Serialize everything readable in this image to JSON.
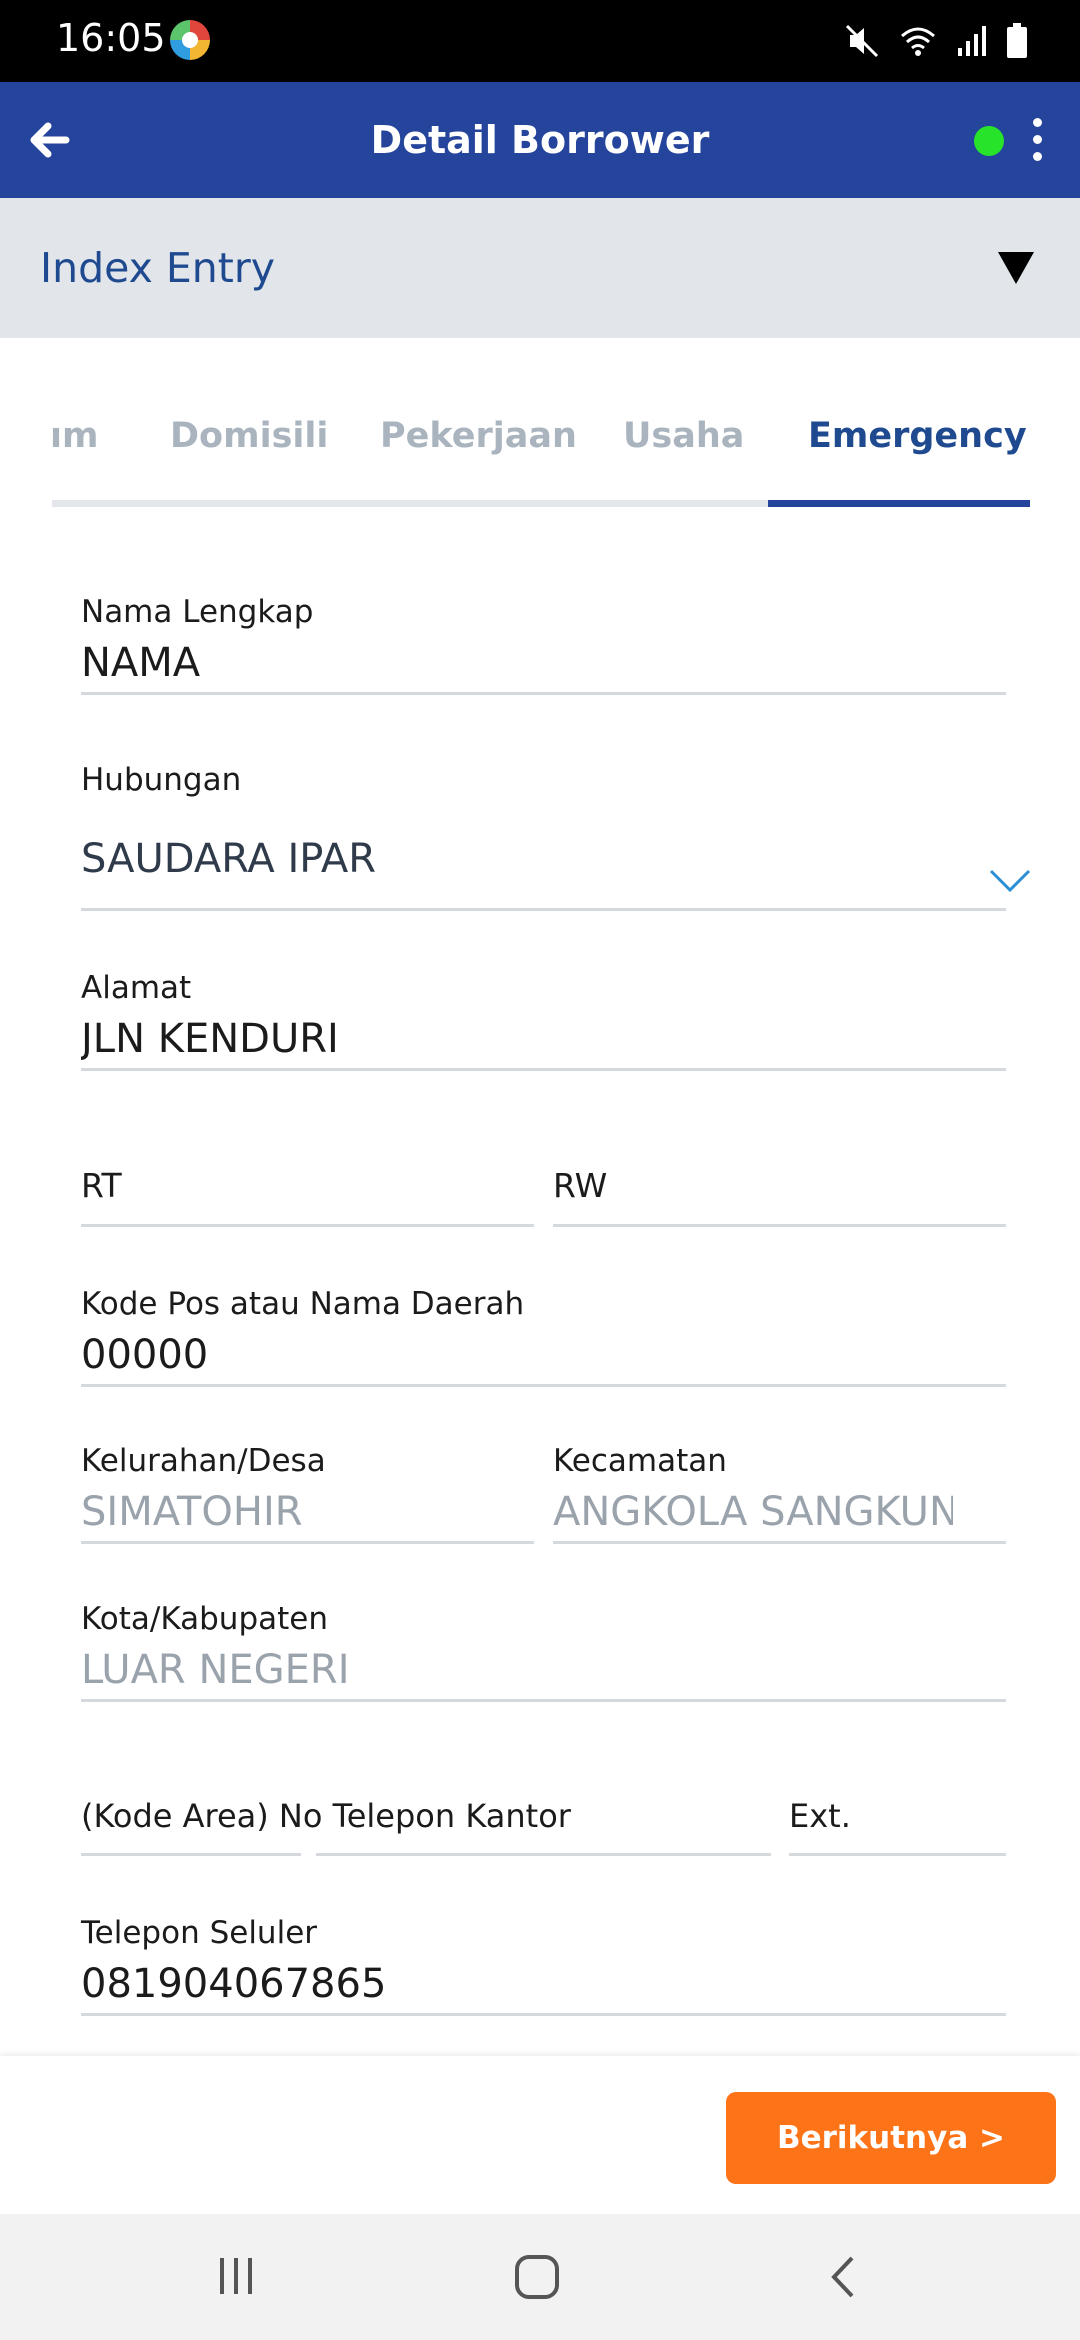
{
  "status_bar": {
    "time": "16:05",
    "icons": [
      "app-notification-icon",
      "mute-icon",
      "wifi-icon",
      "signal-icon",
      "battery-icon"
    ]
  },
  "app_bar": {
    "title": "Detail Borrower",
    "online_color": "#27e32a"
  },
  "index_entry": {
    "title": "Index Entry"
  },
  "tabs": [
    {
      "label": "ım"
    },
    {
      "label": "Domisili"
    },
    {
      "label": "Pekerjaan"
    },
    {
      "label": "Usaha"
    },
    {
      "label": "Emergency",
      "active": true
    }
  ],
  "form": {
    "nama_lengkap": {
      "label": "Nama Lengkap",
      "value": "NAMA"
    },
    "hubungan": {
      "label": "Hubungan",
      "value": "SAUDARA IPAR"
    },
    "alamat": {
      "label": "Alamat",
      "value": "JLN KENDURI"
    },
    "rt": {
      "label": "RT",
      "value": ""
    },
    "rw": {
      "label": "RW",
      "value": ""
    },
    "kode_pos": {
      "label": "Kode Pos atau Nama Daerah",
      "value": "00000"
    },
    "kelurahan": {
      "label": "Kelurahan/Desa",
      "value": "SIMATOHIR"
    },
    "kecamatan": {
      "label": "Kecamatan",
      "value": "ANGKOLA SANGKUNUR"
    },
    "kota": {
      "label": "Kota/Kabupaten",
      "value": "LUAR NEGERI"
    },
    "telepon_kantor": {
      "label": "(Kode Area) No Telepon Kantor",
      "value": ""
    },
    "ext": {
      "label": "Ext.",
      "value": ""
    },
    "telepon_seluler": {
      "label": "Telepon Seluler",
      "value": "081904067865"
    }
  },
  "footer": {
    "next_label": "Berikutnya >"
  },
  "colors": {
    "primary": "#25449b",
    "accent": "#fd7317",
    "index_bg": "#e2e6eb"
  }
}
